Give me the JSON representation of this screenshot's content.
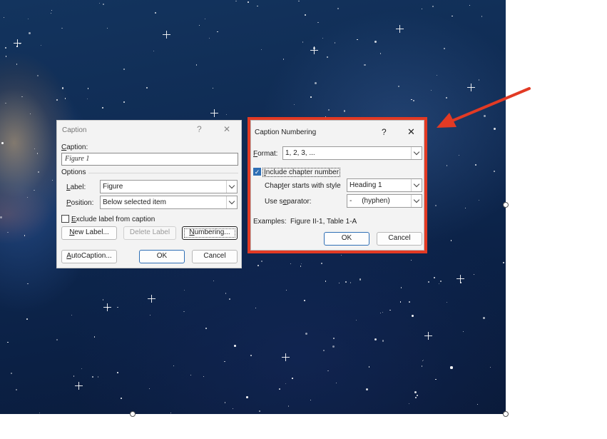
{
  "caption_dialog": {
    "title": "Caption",
    "help_glyph": "?",
    "close_glyph": "✕",
    "caption_label": "Caption:",
    "caption_value": "Figure 1",
    "options_heading": "Options",
    "label_label": "Label:",
    "label_value": "Figure",
    "position_label": "Position:",
    "position_value": "Below selected item",
    "exclude_label": "Exclude label from caption",
    "exclude_checked": false,
    "new_label_button": "New Label...",
    "delete_label_button": "Delete Label",
    "numbering_button": "Numbering...",
    "autocaption_button": "AutoCaption...",
    "ok_button": "OK",
    "cancel_button": "Cancel"
  },
  "numbering_dialog": {
    "title": "Caption Numbering",
    "help_glyph": "?",
    "close_glyph": "✕",
    "format_label": "Format:",
    "format_value": "1, 2, 3, ...",
    "include_chapter_label": "Include chapter number",
    "include_chapter_checked": true,
    "chapter_style_label": "Chapter starts with style",
    "chapter_style_value": "Heading 1",
    "separator_label": "Use separator:",
    "separator_value": "-     (hyphen)",
    "examples_label": "Examples:",
    "examples_value": "Figure II-1, Table 1-A",
    "ok_button": "OK",
    "cancel_button": "Cancel"
  },
  "colors": {
    "highlight": "#e23a24",
    "checkbox_accent": "#2f6fb5"
  }
}
